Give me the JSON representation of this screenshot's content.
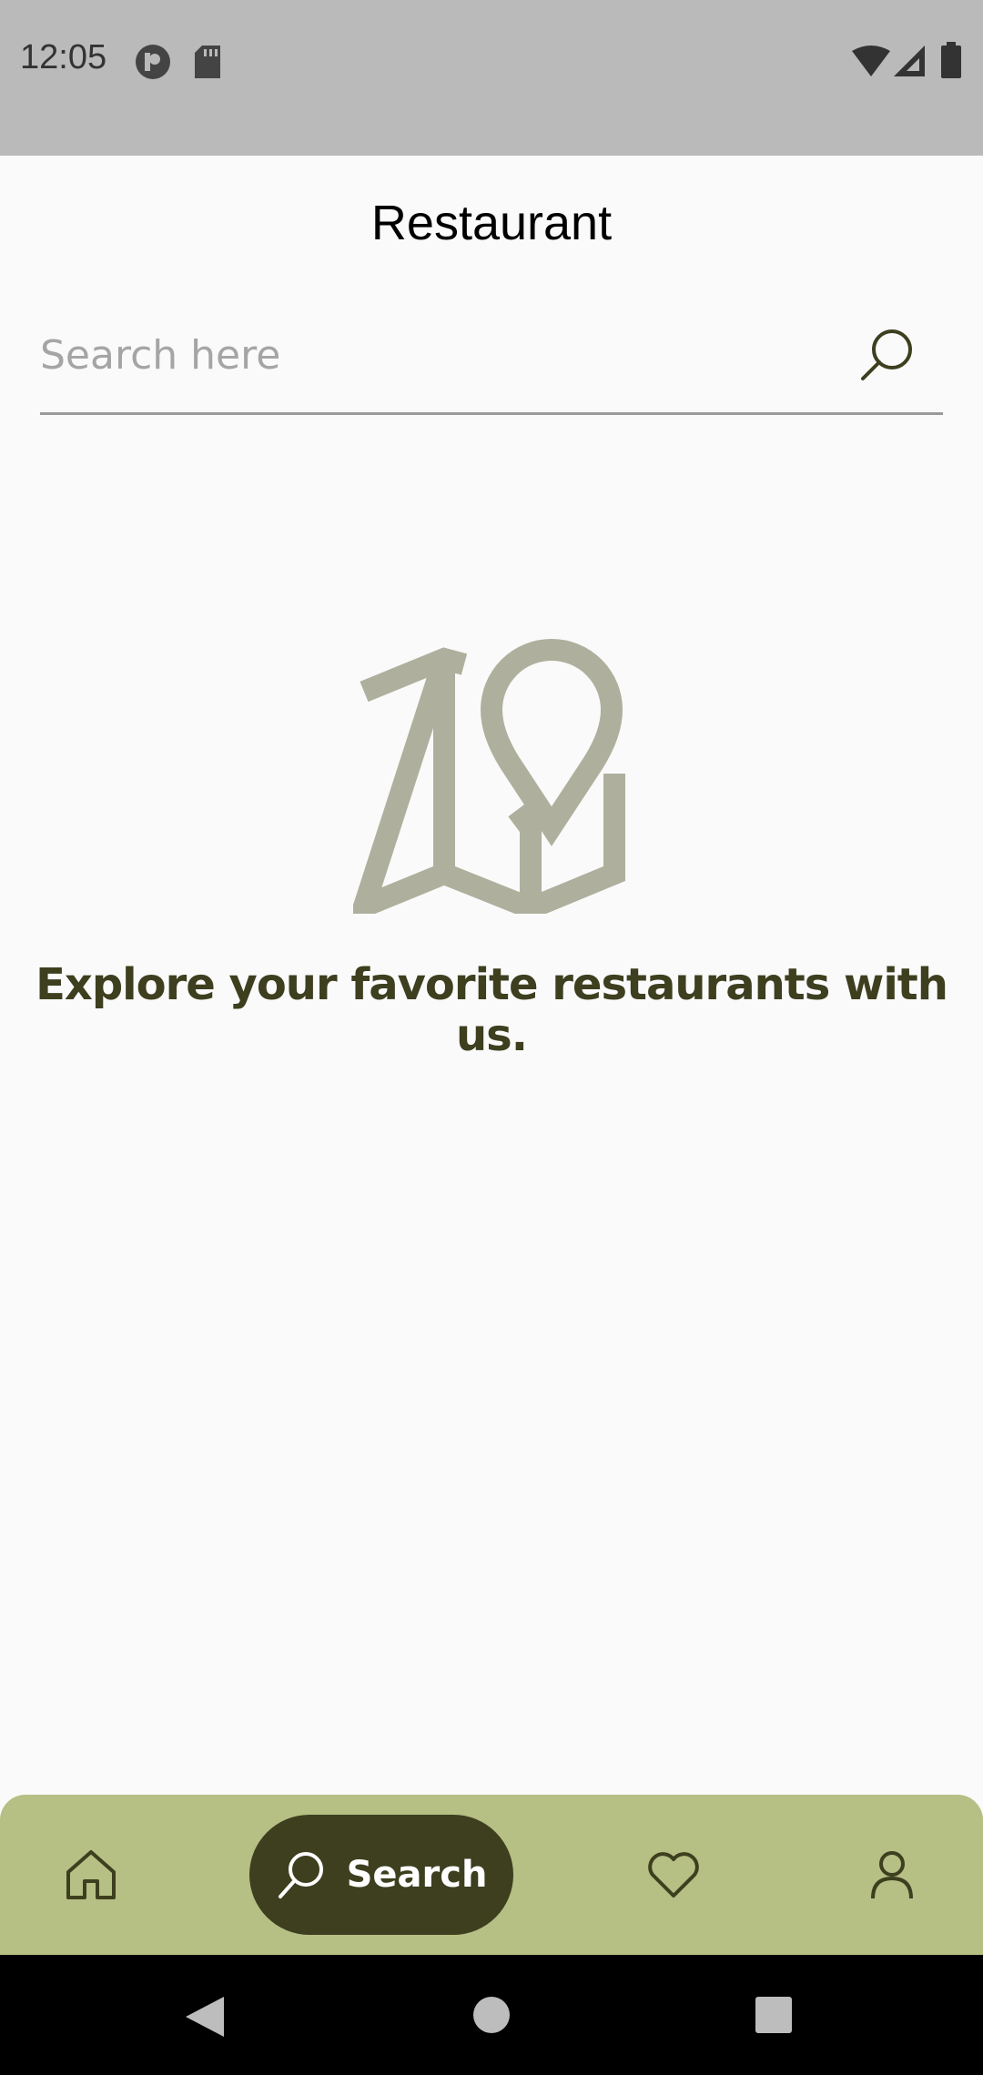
{
  "status_bar": {
    "time": "12:05",
    "icons": [
      "app-notification-icon",
      "sd-card-icon",
      "wifi-icon",
      "cell-signal-icon",
      "battery-icon"
    ]
  },
  "header": {
    "title": "Restaurant"
  },
  "search": {
    "placeholder": "Search here",
    "value": "",
    "icon": "search-icon"
  },
  "empty_state": {
    "icon": "map-pin-icon",
    "message": "Explore your favorite restaurants with us."
  },
  "bottom_nav": {
    "items": [
      {
        "icon": "home-icon",
        "label": ""
      },
      {
        "icon": "search-icon",
        "label": "Search",
        "active": true
      },
      {
        "icon": "heart-icon",
        "label": ""
      },
      {
        "icon": "user-icon",
        "label": ""
      }
    ]
  },
  "system_nav": {
    "buttons": [
      "back-icon",
      "home-circle-icon",
      "recents-icon"
    ]
  },
  "colors": {
    "status_bar_bg": "#bababa",
    "page_bg": "#fafafa",
    "accent_dark": "#3d3f1f",
    "nav_bg": "#b6bf84",
    "illustration": "#aeb09d"
  }
}
